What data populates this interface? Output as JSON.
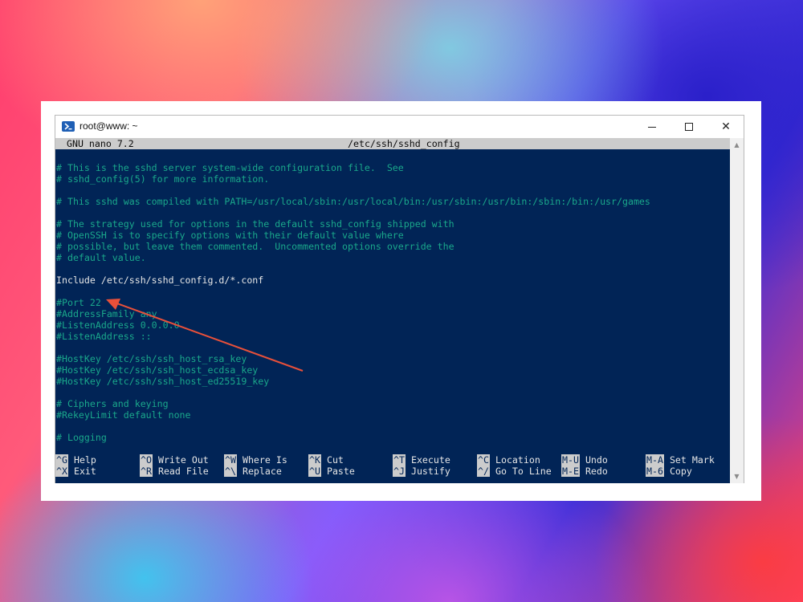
{
  "window": {
    "title": "root@www: ~",
    "controls": {
      "minimize": "",
      "maximize": "",
      "close": "✕"
    }
  },
  "nano": {
    "version": "GNU nano 7.2",
    "filename": "/etc/ssh/sshd_config"
  },
  "lines": [
    {
      "text": "# This is the sshd server system-wide configuration file.  See",
      "kind": "comment"
    },
    {
      "text": "# sshd_config(5) for more information.",
      "kind": "comment"
    },
    {
      "text": "",
      "kind": "plain"
    },
    {
      "text": "# This sshd was compiled with PATH=/usr/local/sbin:/usr/local/bin:/usr/sbin:/usr/bin:/sbin:/bin:/usr/games",
      "kind": "comment"
    },
    {
      "text": "",
      "kind": "plain"
    },
    {
      "text": "# The strategy used for options in the default sshd_config shipped with",
      "kind": "comment"
    },
    {
      "text": "# OpenSSH is to specify options with their default value where",
      "kind": "comment"
    },
    {
      "text": "# possible, but leave them commented.  Uncommented options override the",
      "kind": "comment"
    },
    {
      "text": "# default value.",
      "kind": "comment"
    },
    {
      "text": "",
      "kind": "plain"
    },
    {
      "text": "Include /etc/ssh/sshd_config.d/*.conf",
      "kind": "plain"
    },
    {
      "text": "",
      "kind": "plain"
    },
    {
      "text": "#Port 22",
      "kind": "comment"
    },
    {
      "text": "#AddressFamily any",
      "kind": "comment"
    },
    {
      "text": "#ListenAddress 0.0.0.0",
      "kind": "comment"
    },
    {
      "text": "#ListenAddress ::",
      "kind": "comment"
    },
    {
      "text": "",
      "kind": "plain"
    },
    {
      "text": "#HostKey /etc/ssh/ssh_host_rsa_key",
      "kind": "comment"
    },
    {
      "text": "#HostKey /etc/ssh/ssh_host_ecdsa_key",
      "kind": "comment"
    },
    {
      "text": "#HostKey /etc/ssh/ssh_host_ed25519_key",
      "kind": "comment"
    },
    {
      "text": "",
      "kind": "plain"
    },
    {
      "text": "# Ciphers and keying",
      "kind": "comment"
    },
    {
      "text": "#RekeyLimit default none",
      "kind": "comment"
    },
    {
      "text": "",
      "kind": "plain"
    },
    {
      "text": "# Logging",
      "kind": "comment"
    }
  ],
  "shortcuts": [
    {
      "key": "^G",
      "label": "Help"
    },
    {
      "key": "^X",
      "label": "Exit"
    },
    {
      "key": "^O",
      "label": "Write Out"
    },
    {
      "key": "^R",
      "label": "Read File"
    },
    {
      "key": "^W",
      "label": "Where Is"
    },
    {
      "key": "^\\",
      "label": "Replace"
    },
    {
      "key": "^K",
      "label": "Cut"
    },
    {
      "key": "^U",
      "label": "Paste"
    },
    {
      "key": "^T",
      "label": "Execute"
    },
    {
      "key": "^J",
      "label": "Justify"
    },
    {
      "key": "^C",
      "label": "Location"
    },
    {
      "key": "^/",
      "label": "Go To Line"
    },
    {
      "key": "M-U",
      "label": "Undo"
    },
    {
      "key": "M-E",
      "label": "Redo"
    },
    {
      "key": "M-A",
      "label": "Set Mark"
    },
    {
      "key": "M-6",
      "label": "Copy"
    }
  ],
  "colors": {
    "terminal_bg": "#012456",
    "comment": "#1aa88b",
    "annotation_arrow": "#e8503a"
  }
}
